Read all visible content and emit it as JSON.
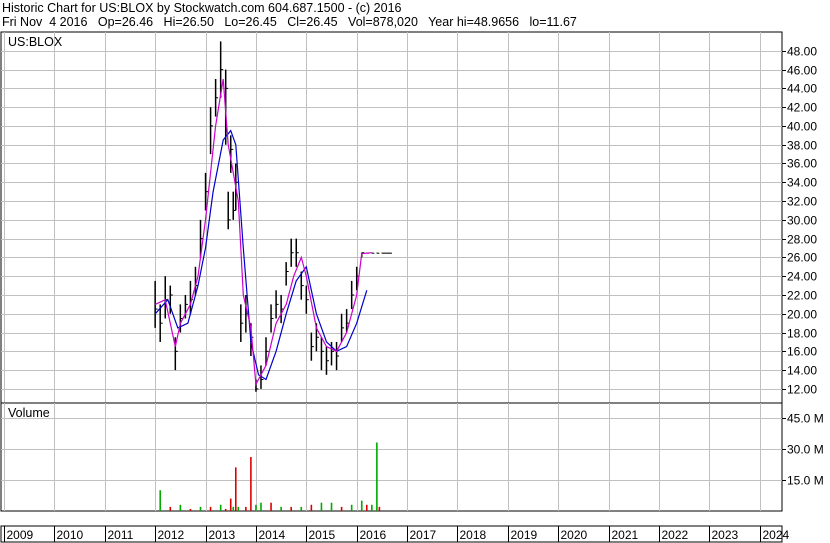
{
  "header": {
    "line1": "Historic Chart for US:BLOX by Stockwatch.com 604.687.1500 - (c) 2016",
    "line2": "Fri Nov  4 2016   Op=26.46   Hi=26.50   Lo=26.45   Cl=26.45   Vol=878,020   Year hi=48.9656   lo=11.67"
  },
  "colors": {
    "grid": "#c0c0c0",
    "price_bar": "#000000",
    "short_ma": "#cc00cc",
    "long_ma": "#0000cc",
    "volume_up": "#00aa00",
    "volume_down": "#dd0000"
  },
  "chart_data": [
    {
      "type": "line",
      "panel": "price",
      "title": "US:BLOX",
      "xlabel": "",
      "ylabel": "",
      "ylim": [
        10.5,
        50
      ],
      "yticks": [
        12,
        14,
        16,
        18,
        20,
        22,
        24,
        26,
        28,
        30,
        32,
        34,
        36,
        38,
        40,
        42,
        44,
        46,
        48
      ],
      "ytick_labels": [
        "12.00",
        "14.00",
        "16.00",
        "18.00",
        "20.00",
        "22.00",
        "24.00",
        "26.00",
        "28.00",
        "30.00",
        "32.00",
        "34.00",
        "36.00",
        "38.00",
        "40.00",
        "42.00",
        "44.00",
        "46.00",
        "48.00"
      ],
      "grid": true,
      "series": [
        {
          "style": "ohlc-bars",
          "x": [
            2012.0,
            2012.1,
            2012.2,
            2012.3,
            2012.4,
            2012.5,
            2012.6,
            2012.7,
            2012.8,
            2012.9,
            2013.0,
            2013.1,
            2013.2,
            2013.3,
            2013.4,
            2013.45,
            2013.5,
            2013.55,
            2013.6,
            2013.7,
            2013.8,
            2013.9,
            2014.0,
            2014.1,
            2014.2,
            2014.3,
            2014.4,
            2014.5,
            2014.6,
            2014.7,
            2014.8,
            2014.9,
            2015.0,
            2015.1,
            2015.2,
            2015.3,
            2015.4,
            2015.5,
            2015.6,
            2015.7,
            2015.8,
            2015.9,
            2016.0,
            2016.1,
            2016.2,
            2016.3,
            2016.4,
            2016.5,
            2016.55,
            2016.6,
            2016.65
          ],
          "values": [
            20.5,
            19.0,
            21.5,
            22.0,
            16.0,
            19.5,
            21.0,
            21.5,
            23.0,
            28.0,
            33.0,
            40.0,
            43.0,
            46.0,
            44.0,
            30.0,
            37.5,
            31.0,
            34.0,
            19.0,
            20.0,
            17.5,
            12.0,
            13.0,
            16.0,
            19.5,
            21.0,
            20.5,
            24.5,
            26.5,
            26.5,
            23.0,
            21.5,
            16.5,
            17.5,
            16.0,
            15.0,
            16.0,
            15.5,
            18.5,
            19.0,
            22.0,
            24.0,
            26.5,
            26.45,
            26.45,
            26.45,
            26.45,
            26.45,
            26.45,
            26.45
          ],
          "high": [
            23.5,
            21.0,
            24.0,
            23.0,
            17.5,
            21.0,
            22.0,
            23.5,
            25.0,
            30.0,
            35.0,
            42.0,
            45.0,
            49.0,
            46.0,
            33.0,
            39.0,
            33.0,
            36.0,
            21.0,
            22.0,
            19.0,
            13.0,
            14.5,
            17.5,
            21.0,
            22.5,
            22.0,
            25.5,
            28.0,
            28.0,
            24.5,
            23.0,
            18.0,
            19.0,
            17.5,
            16.5,
            17.0,
            17.0,
            20.0,
            20.5,
            23.5,
            25.0,
            26.5,
            26.5,
            26.5,
            26.5,
            26.5,
            26.5,
            26.5,
            26.5
          ],
          "low": [
            18.5,
            17.0,
            19.5,
            20.0,
            14.0,
            18.0,
            19.5,
            20.0,
            22.0,
            26.0,
            31.0,
            37.0,
            41.0,
            43.0,
            38.0,
            29.0,
            35.0,
            30.0,
            31.0,
            17.0,
            18.0,
            15.5,
            11.7,
            12.0,
            14.5,
            18.0,
            19.5,
            19.0,
            23.0,
            25.0,
            25.0,
            21.5,
            20.0,
            15.0,
            16.0,
            14.0,
            13.5,
            14.5,
            14.0,
            17.0,
            18.0,
            20.5,
            22.5,
            26.0,
            26.45,
            26.45,
            26.45,
            26.45,
            26.45,
            26.45,
            26.45
          ]
        },
        {
          "style": "line",
          "color": "#cc00cc",
          "x": [
            2012.0,
            2012.2,
            2012.4,
            2012.5,
            2012.7,
            2012.85,
            2013.0,
            2013.2,
            2013.35,
            2013.45,
            2013.55,
            2013.65,
            2013.75,
            2013.9,
            2014.0,
            2014.2,
            2014.4,
            2014.6,
            2014.75,
            2014.9,
            2015.0,
            2015.2,
            2015.4,
            2015.6,
            2015.8,
            2016.0,
            2016.1,
            2016.3
          ],
          "values": [
            21.0,
            21.5,
            16.5,
            19.0,
            21.0,
            24.0,
            30.0,
            40.0,
            45.0,
            38.0,
            35.0,
            32.0,
            22.0,
            18.5,
            12.5,
            14.5,
            19.0,
            21.0,
            24.0,
            26.0,
            24.0,
            18.5,
            16.5,
            16.0,
            18.0,
            22.0,
            26.4,
            26.5
          ]
        },
        {
          "style": "line",
          "color": "#0000cc",
          "x": [
            2012.0,
            2012.25,
            2012.45,
            2012.65,
            2012.85,
            2013.0,
            2013.15,
            2013.35,
            2013.5,
            2013.6,
            2013.75,
            2013.9,
            2014.05,
            2014.2,
            2014.4,
            2014.6,
            2014.8,
            2015.0,
            2015.2,
            2015.4,
            2015.6,
            2015.8,
            2016.0,
            2016.2
          ],
          "values": [
            20.0,
            21.5,
            18.5,
            19.0,
            23.0,
            27.0,
            33.0,
            38.5,
            39.5,
            38.0,
            27.0,
            17.0,
            13.5,
            13.0,
            16.0,
            20.0,
            23.5,
            25.0,
            20.0,
            17.0,
            16.0,
            16.5,
            19.0,
            22.5
          ]
        }
      ]
    },
    {
      "type": "bar",
      "panel": "volume",
      "title": "Volume",
      "xlabel": "",
      "ylabel": "",
      "ylim": [
        0,
        52
      ],
      "yticks": [
        15,
        30,
        45
      ],
      "ytick_labels": [
        "15.0 M",
        "30.0 M",
        "45.0 M"
      ],
      "grid": true,
      "x": [
        2012.1,
        2012.3,
        2012.5,
        2012.7,
        2012.9,
        2013.1,
        2013.3,
        2013.4,
        2013.5,
        2013.55,
        2013.6,
        2013.65,
        2013.8,
        2013.9,
        2014.0,
        2014.1,
        2014.3,
        2014.5,
        2014.7,
        2014.9,
        2015.1,
        2015.3,
        2015.5,
        2015.7,
        2015.9,
        2016.1,
        2016.2,
        2016.3,
        2016.4,
        2016.45
      ],
      "values": [
        10,
        2,
        3,
        1,
        2,
        2,
        3,
        1,
        6,
        2,
        21,
        2,
        2,
        26,
        3,
        4,
        4,
        2,
        2,
        2,
        3,
        4,
        4,
        2,
        3,
        5,
        3,
        3,
        33,
        2
      ],
      "colors": [
        "#00aa00",
        "#dd0000",
        "#00aa00",
        "#dd0000",
        "#00aa00",
        "#dd0000",
        "#00aa00",
        "#dd0000",
        "#dd0000",
        "#00aa00",
        "#dd0000",
        "#00aa00",
        "#dd0000",
        "#dd0000",
        "#00aa00",
        "#00aa00",
        "#dd0000",
        "#00aa00",
        "#dd0000",
        "#00aa00",
        "#dd0000",
        "#00aa00",
        "#00aa00",
        "#dd0000",
        "#00aa00",
        "#00aa00",
        "#dd0000",
        "#00aa00",
        "#00aa00",
        "#dd0000"
      ]
    }
  ],
  "x_axis": {
    "labels": [
      "2009",
      "2010",
      "2011",
      "2012",
      "2013",
      "2014",
      "2015",
      "2016",
      "2017",
      "2018",
      "2019",
      "2020",
      "2021",
      "2022",
      "2023",
      "2024"
    ],
    "years": [
      2009,
      2010,
      2011,
      2012,
      2013,
      2014,
      2015,
      2016,
      2017,
      2018,
      2019,
      2020,
      2021,
      2022,
      2023,
      2024
    ]
  }
}
